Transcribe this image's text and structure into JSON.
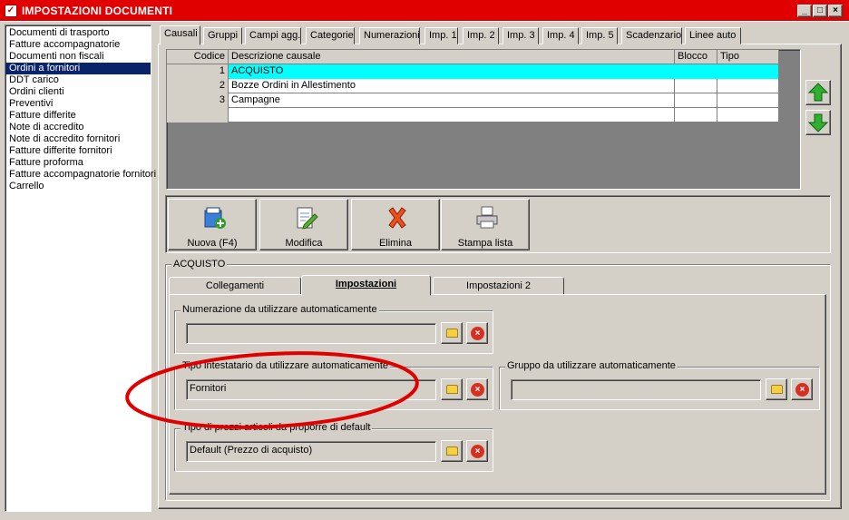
{
  "window": {
    "title": "IMPOSTAZIONI DOCUMENTI",
    "minimize": "_",
    "maximize": "□",
    "close": "×"
  },
  "doc_types": [
    "Documenti di trasporto",
    "Fatture accompagnatorie",
    "Documenti non fiscali",
    "Ordini a fornitori",
    "DDT carico",
    "Ordini clienti",
    "Preventivi",
    "Fatture differite",
    "Note di accredito",
    "Note di accredito fornitori",
    "Fatture differite fornitori",
    "Fatture proforma",
    "Fatture accompagnatorie fornitori",
    "Carrello"
  ],
  "doc_types_selected": "Ordini a fornitori",
  "tabs": [
    "Causali",
    "Gruppi",
    "Campi agg.",
    "Categorie",
    "Numerazioni",
    "Imp. 1",
    "Imp. 2",
    "Imp. 3",
    "Imp. 4",
    "Imp. 5",
    "Scadenzario",
    "Linee auto"
  ],
  "grid": {
    "columns": [
      "Codice",
      "Descrizione causale",
      "Blocco",
      "Tipo"
    ],
    "rows": [
      {
        "codice": "1",
        "descrizione": "ACQUISTO",
        "blocco": "",
        "tipo": ""
      },
      {
        "codice": "2",
        "descrizione": "Bozze Ordini in Allestimento",
        "blocco": "",
        "tipo": ""
      },
      {
        "codice": "3",
        "descrizione": "Campagne",
        "blocco": "",
        "tipo": ""
      }
    ]
  },
  "toolbar": {
    "nuova": "Nuova (F4)",
    "modifica": "Modifica",
    "elimina": "Elimina",
    "stampa": "Stampa lista"
  },
  "detail": {
    "group_title": "ACQUISTO",
    "subtabs": [
      "Collegamenti",
      "Impostazioni",
      "Impostazioni 2"
    ],
    "numerazione_label": "Numerazione da utilizzare automaticamente",
    "numerazione_value": "",
    "tipo_intestatario_label": "Tipo intestatario da utilizzare automaticamente",
    "tipo_intestatario_value": "Fornitori",
    "gruppo_label": "Gruppo da utilizzare automaticamente",
    "gruppo_value": "",
    "tipo_prezzi_label": "Tipo di prezzi articoli da proporre di default",
    "tipo_prezzi_value": "Default (Prezzo di acquisto)"
  },
  "colors": {
    "title_bar": "#e00000",
    "selection_row": "#00ffff",
    "list_selection": "#0a246a",
    "annotation": "#e00000"
  }
}
